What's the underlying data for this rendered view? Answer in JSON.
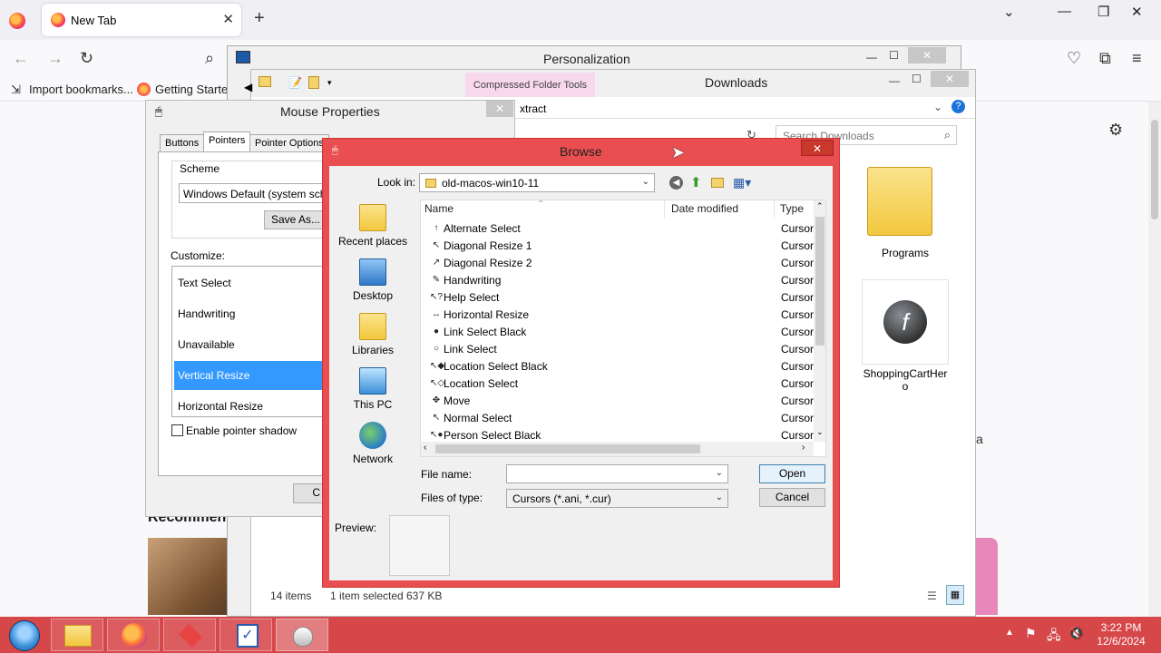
{
  "browser": {
    "tab_title": "New Tab",
    "bookmarks": [
      "Import bookmarks...",
      "Getting Started"
    ]
  },
  "personalization": {
    "title": "Personalization"
  },
  "explorer": {
    "title": "Downloads",
    "ribbon_tab": "Compressed Folder Tools",
    "ribbon_action": "xtract",
    "search_placeholder": "Search Downloads",
    "items": [
      {
        "label": "Programs"
      },
      {
        "label": "ShoppingCartHero"
      }
    ],
    "status_count": "14 items",
    "status_selected": "1 item selected",
    "status_size": "637 KB"
  },
  "mouse_properties": {
    "title": "Mouse Properties",
    "tabs": [
      "Buttons",
      "Pointers",
      "Pointer Options"
    ],
    "scheme_label": "Scheme",
    "scheme_value": "Windows Default (system schem",
    "save_as": "Save As...",
    "customize_label": "Customize:",
    "list": [
      "Text Select",
      "Handwriting",
      "Unavailable",
      "Vertical Resize",
      "Horizontal Resize"
    ],
    "shadow_label": "Enable pointer shadow",
    "partial_button": "C"
  },
  "browse": {
    "title": "Browse",
    "look_in_label": "Look in:",
    "look_in_value": "old-macos-win10-11",
    "places": [
      "Recent places",
      "Desktop",
      "Libraries",
      "This PC",
      "Network"
    ],
    "columns": {
      "name": "Name",
      "date": "Date modified",
      "type": "Type"
    },
    "files": [
      {
        "name": "Alternate Select",
        "type": "Cursor",
        "icon": "↑"
      },
      {
        "name": "Diagonal Resize 1",
        "type": "Cursor",
        "icon": "↖"
      },
      {
        "name": "Diagonal Resize 2",
        "type": "Cursor",
        "icon": "↗"
      },
      {
        "name": "Handwriting",
        "type": "Cursor",
        "icon": "✎"
      },
      {
        "name": "Help Select",
        "type": "Cursor",
        "icon": "↖?"
      },
      {
        "name": "Horizontal Resize",
        "type": "Cursor",
        "icon": "↔"
      },
      {
        "name": "Link Select Black",
        "type": "Cursor",
        "icon": "●"
      },
      {
        "name": "Link Select",
        "type": "Cursor",
        "icon": "○"
      },
      {
        "name": "Location Select Black",
        "type": "Cursor",
        "icon": "↖◆"
      },
      {
        "name": "Location Select",
        "type": "Cursor",
        "icon": "↖◇"
      },
      {
        "name": "Move",
        "type": "Cursor",
        "icon": "✥"
      },
      {
        "name": "Normal Select",
        "type": "Cursor",
        "icon": "↖"
      },
      {
        "name": "Person Select Black",
        "type": "Cursor",
        "icon": "↖●"
      }
    ],
    "file_name_label": "File name:",
    "file_name_value": "",
    "files_of_type_label": "Files of type:",
    "files_of_type_value": "Cursors (*.ani, *.cur)",
    "open": "Open",
    "cancel": "Cancel",
    "preview_label": "Preview:"
  },
  "page": {
    "recommend_text": "Recommen",
    "side_text": "a"
  },
  "taskbar": {
    "time": "3:22 PM",
    "date": "12/6/2024"
  },
  "colors": {
    "taskbar": "#d6474a",
    "browse_frame": "#e94e50",
    "selection": "#3399ff"
  }
}
